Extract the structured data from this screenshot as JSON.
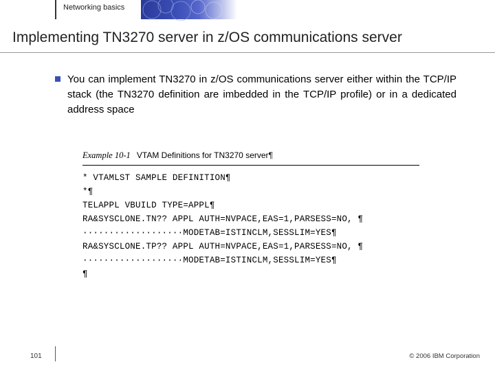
{
  "header": {
    "breadcrumb": "Networking basics"
  },
  "title": "Implementing TN3270 server in z/OS communications server",
  "bullet": {
    "text": "You can implement TN3270 in z/OS communications server either within the TCP/IP stack (the TN3270 definition are imbedded in the TCP/IP profile) or in a dedicated address space"
  },
  "code": {
    "caption_prefix": "Example 10-1",
    "caption_rest": "VTAM Definitions for TN3270 server¶",
    "lines": [
      "* VTAMLST SAMPLE DEFINITION¶",
      "*¶",
      "TELAPPL VBUILD TYPE=APPL¶",
      "RA&SYSCLONE.TN?? APPL AUTH=NVPACE,EAS=1,PARSESS=NO, ¶",
      "···················MODETAB=ISTINCLM,SESSLIM=YES¶",
      "RA&SYSCLONE.TP?? APPL AUTH=NVPACE,EAS=1,PARSESS=NO, ¶",
      "···················MODETAB=ISTINCLM,SESSLIM=YES¶",
      "¶"
    ]
  },
  "footer": {
    "page": "101",
    "copyright": "© 2006 IBM Corporation"
  }
}
